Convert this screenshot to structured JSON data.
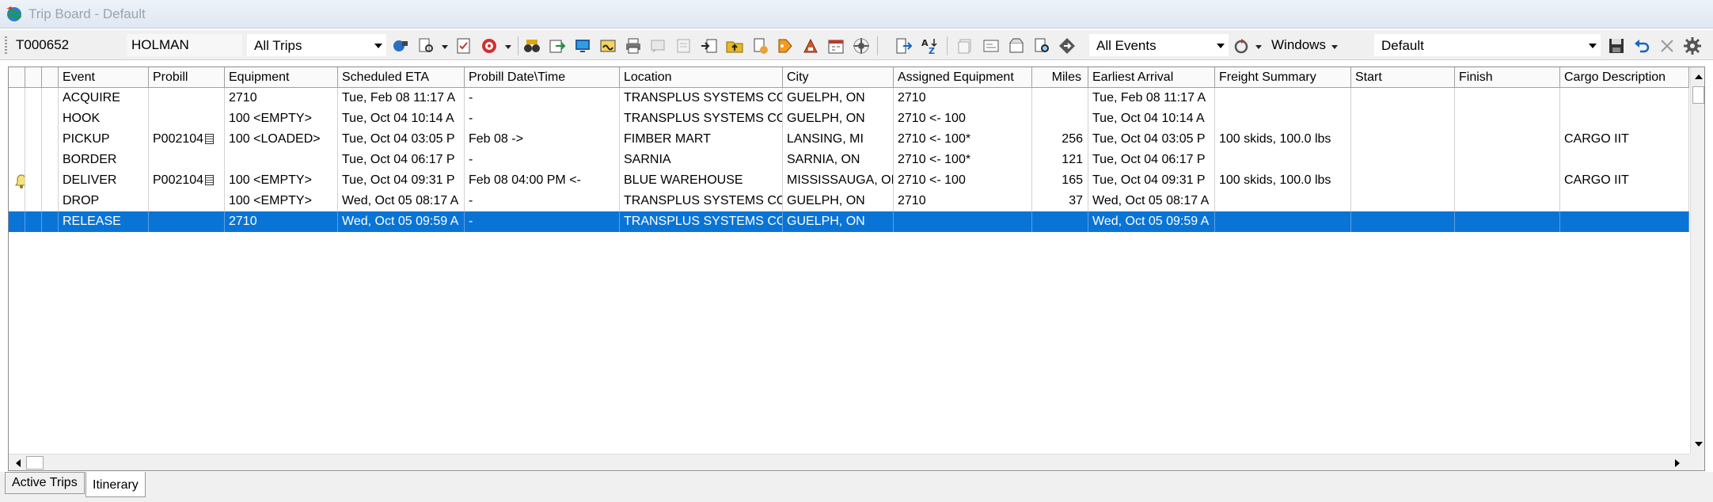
{
  "window": {
    "title": "Trip Board - Default"
  },
  "toolbar": {
    "trip_number": "T000652",
    "driver": "HOLMAN",
    "trips_filter": "All Trips",
    "events_filter": "All Events",
    "windows_label": "Windows",
    "layout": "Default"
  },
  "grid": {
    "columns": [
      "",
      "",
      "",
      "Event",
      "Probill",
      "Equipment",
      "Scheduled ETA",
      "Probill Date\\Time",
      "Location",
      "City",
      "Assigned Equipment",
      "Miles",
      "Earliest Arrival",
      "Freight Summary",
      "Start",
      "Finish",
      "Cargo Description"
    ],
    "rows": [
      {
        "event": "ACQUIRE",
        "probill": "",
        "equipment": "2710",
        "eta": "Tue, Feb 08 11:17 A",
        "probill_dt": "-",
        "location": "TRANSPLUS SYSTEMS CO",
        "city": "GUELPH, ON",
        "assigned": "2710",
        "miles": "",
        "earliest": "Tue, Feb 08 11:17 A",
        "freight": "",
        "start": "",
        "finish": "",
        "cargo": ""
      },
      {
        "event": "HOOK",
        "probill": "",
        "equipment": "100 <EMPTY>",
        "eta": "Tue, Oct 04 10:14 A",
        "probill_dt": "-",
        "location": "TRANSPLUS SYSTEMS CO",
        "city": "GUELPH, ON",
        "assigned": "2710 <- 100",
        "miles": "",
        "earliest": "Tue, Oct 04 10:14 A",
        "freight": "",
        "start": "",
        "finish": "",
        "cargo": ""
      },
      {
        "event": "PICKUP",
        "probill": "P002104",
        "equipment": "100 <LOADED>",
        "eta": "Tue, Oct 04 03:05 P",
        "probill_dt": "Feb 08 ->",
        "location": "FIMBER MART",
        "city": "LANSING, MI",
        "assigned": "2710 <- 100*",
        "miles": "256",
        "earliest": "Tue, Oct 04 03:05 P",
        "freight": "100 skids, 100.0 lbs",
        "start": "",
        "finish": "",
        "cargo": "CARGO IIT"
      },
      {
        "event": "BORDER",
        "probill": "",
        "equipment": "",
        "eta": "Tue, Oct 04 06:17 P",
        "probill_dt": "-",
        "location": "SARNIA",
        "city": "SARNIA, ON",
        "assigned": "2710 <- 100*",
        "miles": "121",
        "earliest": "Tue, Oct 04 06:17 P",
        "freight": "",
        "start": "",
        "finish": "",
        "cargo": ""
      },
      {
        "event": "DELIVER",
        "probill": "P002104",
        "equipment": "100 <EMPTY>",
        "eta": "Tue, Oct 04 09:31 P",
        "probill_dt": "Feb 08 04:00 PM <-",
        "location": "BLUE WAREHOUSE",
        "city": "MISSISSAUGA, ON",
        "assigned": "2710 <- 100",
        "miles": "165",
        "earliest": "Tue, Oct 04 09:31 P",
        "freight": "100 skids, 100.0 lbs",
        "start": "",
        "finish": "",
        "cargo": "CARGO IIT"
      },
      {
        "event": "DROP",
        "probill": "",
        "equipment": "100 <EMPTY>",
        "eta": "Wed, Oct 05 08:17 A",
        "probill_dt": "-",
        "location": "TRANSPLUS SYSTEMS CO",
        "city": "GUELPH, ON",
        "assigned": "2710",
        "miles": "37",
        "earliest": "Wed, Oct 05 08:17 A",
        "freight": "",
        "start": "",
        "finish": "",
        "cargo": ""
      },
      {
        "event": "RELEASE",
        "probill": "",
        "equipment": "2710",
        "eta": "Wed, Oct 05 09:59 A",
        "probill_dt": "-",
        "location": "TRANSPLUS SYSTEMS CO",
        "city": "GUELPH, ON",
        "assigned": "",
        "miles": "",
        "earliest": "Wed, Oct 05 09:59 A",
        "freight": "",
        "start": "",
        "finish": "",
        "cargo": ""
      }
    ],
    "selected_row": 6,
    "alert_row": 4,
    "probill_icon_rows": [
      2,
      4
    ]
  },
  "tabs": [
    {
      "label": "Active Trips",
      "active": false
    },
    {
      "label": "Itinerary",
      "active": true
    }
  ],
  "colors": {
    "selection": "#0a74d6",
    "window_bg": "#f0f0f0"
  }
}
